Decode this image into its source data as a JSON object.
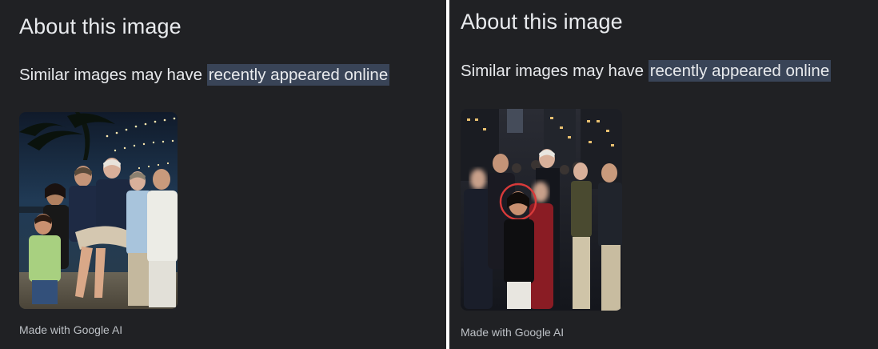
{
  "panels": [
    {
      "title": "About this image",
      "subtitle_prefix": "Similar images may have ",
      "subtitle_highlight": "recently appeared online",
      "credit": "Made with Google AI"
    },
    {
      "title": "About this image",
      "subtitle_prefix": "Similar images may have ",
      "subtitle_highlight": "recently appeared online",
      "credit": "Made with Google AI"
    }
  ],
  "colors": {
    "panel_bg": "#202124",
    "text": "#e8eaed",
    "highlight_bg": "#394457",
    "credit_text": "#bdc1c6"
  }
}
